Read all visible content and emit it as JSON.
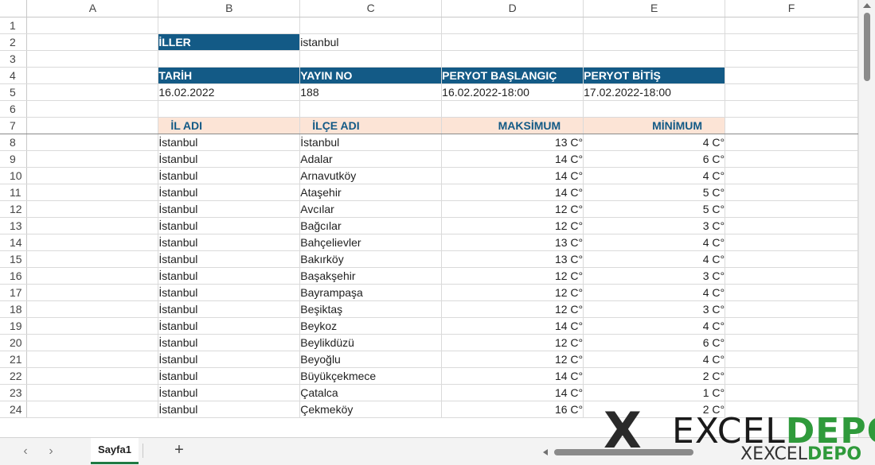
{
  "columns": [
    "A",
    "B",
    "C",
    "D",
    "E",
    "F"
  ],
  "rows": {
    "r2": {
      "iller_label": "İLLER",
      "iller_value": "istanbul"
    },
    "r4": {
      "b": "TARİH",
      "c": "YAYIN NO",
      "d": "PERYOT BAŞLANGIÇ",
      "e": "PERYOT BİTİŞ"
    },
    "r5": {
      "b": "16.02.2022",
      "c": "188",
      "d": "16.02.2022-18:00",
      "e": "17.02.2022-18:00"
    },
    "r7": {
      "b": "İL ADI",
      "c": "İLÇE ADI",
      "d": "MAKSİMUM",
      "e": "MİNİMUM"
    }
  },
  "row_numbers": [
    "1",
    "2",
    "3",
    "4",
    "5",
    "6",
    "7",
    "8",
    "9",
    "10",
    "11",
    "12",
    "13",
    "14",
    "15",
    "16",
    "17",
    "18",
    "19",
    "20",
    "21",
    "22",
    "23",
    "24"
  ],
  "data_rows": [
    {
      "row": "8",
      "il": "İstanbul",
      "ilce": "İstanbul",
      "max": "13 C°",
      "min": "4 C°"
    },
    {
      "row": "9",
      "il": "İstanbul",
      "ilce": "Adalar",
      "max": "14 C°",
      "min": "6 C°"
    },
    {
      "row": "10",
      "il": "İstanbul",
      "ilce": "Arnavutköy",
      "max": "14 C°",
      "min": "4 C°"
    },
    {
      "row": "11",
      "il": "İstanbul",
      "ilce": "Ataşehir",
      "max": "14 C°",
      "min": "5 C°"
    },
    {
      "row": "12",
      "il": "İstanbul",
      "ilce": "Avcılar",
      "max": "12 C°",
      "min": "5 C°"
    },
    {
      "row": "13",
      "il": "İstanbul",
      "ilce": "Bağcılar",
      "max": "12 C°",
      "min": "3 C°"
    },
    {
      "row": "14",
      "il": "İstanbul",
      "ilce": "Bahçelievler",
      "max": "13 C°",
      "min": "4 C°"
    },
    {
      "row": "15",
      "il": "İstanbul",
      "ilce": "Bakırköy",
      "max": "13 C°",
      "min": "4 C°"
    },
    {
      "row": "16",
      "il": "İstanbul",
      "ilce": "Başakşehir",
      "max": "12 C°",
      "min": "3 C°"
    },
    {
      "row": "17",
      "il": "İstanbul",
      "ilce": "Bayrampaşa",
      "max": "12 C°",
      "min": "4 C°"
    },
    {
      "row": "18",
      "il": "İstanbul",
      "ilce": "Beşiktaş",
      "max": "12 C°",
      "min": "3 C°"
    },
    {
      "row": "19",
      "il": "İstanbul",
      "ilce": "Beykoz",
      "max": "14 C°",
      "min": "4 C°"
    },
    {
      "row": "20",
      "il": "İstanbul",
      "ilce": "Beylikdüzü",
      "max": "12 C°",
      "min": "6 C°"
    },
    {
      "row": "21",
      "il": "İstanbul",
      "ilce": "Beyoğlu",
      "max": "12 C°",
      "min": "4 C°"
    },
    {
      "row": "22",
      "il": "İstanbul",
      "ilce": "Büyükçekmece",
      "max": "14 C°",
      "min": "2 C°"
    },
    {
      "row": "23",
      "il": "İstanbul",
      "ilce": "Çatalca",
      "max": "14 C°",
      "min": "1 C°"
    },
    {
      "row": "24",
      "il": "İstanbul",
      "ilce": "Çekmeköy",
      "max": "16 C°",
      "min": "2 C°"
    }
  ],
  "tabs": {
    "sheet1": "Sayfa1",
    "add": "+"
  },
  "nav": {
    "prev": "‹",
    "next": "›"
  },
  "watermark": {
    "brand_excel": "EXCEL",
    "brand_depo": "DEPO",
    "mark": "X"
  },
  "colors": {
    "header_blue": "#135a86",
    "header_peach": "#fce4d6",
    "accent_green": "#1f7a43"
  }
}
